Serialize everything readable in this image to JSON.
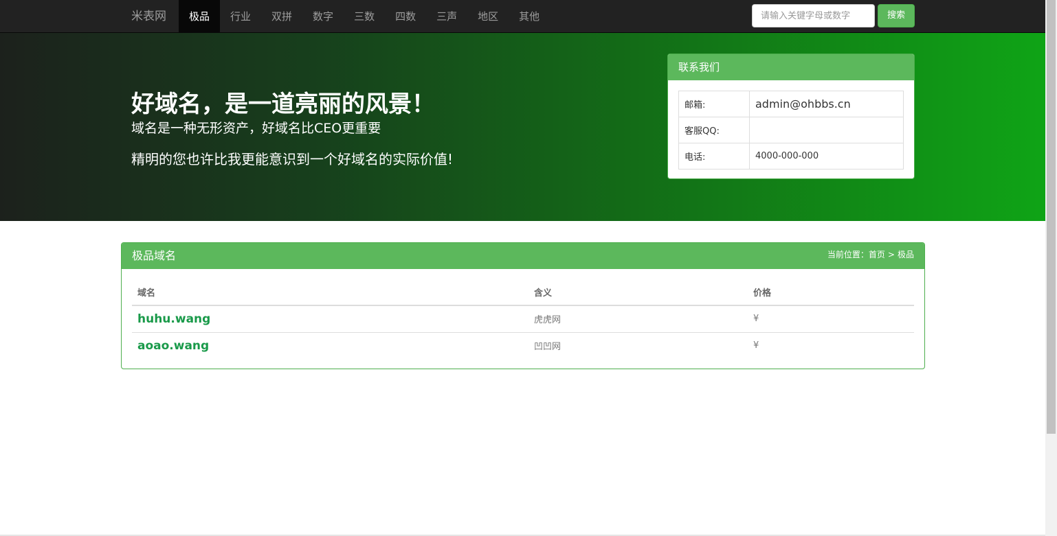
{
  "nav": {
    "brand": "米表网",
    "items": [
      {
        "label": "极品",
        "active": true
      },
      {
        "label": "行业",
        "active": false
      },
      {
        "label": "双拼",
        "active": false
      },
      {
        "label": "数字",
        "active": false
      },
      {
        "label": "三数",
        "active": false
      },
      {
        "label": "四数",
        "active": false
      },
      {
        "label": "三声",
        "active": false
      },
      {
        "label": "地区",
        "active": false
      },
      {
        "label": "其他",
        "active": false
      }
    ],
    "search_placeholder": "请输入关键字母或数字",
    "search_button": "搜索"
  },
  "hero": {
    "title": "好域名，是一道亮丽的风景！",
    "subtitle": "域名是一种无形资产，好域名比CEO更重要",
    "description": "精明的您也许比我更能意识到一个好域名的实际价值!"
  },
  "contact": {
    "heading": "联系我们",
    "rows": [
      {
        "label": "邮箱:",
        "value": "admin@ohbbs.cn"
      },
      {
        "label": "客服QQ:",
        "value": ""
      },
      {
        "label": "电话:",
        "value": "4000-000-000"
      }
    ]
  },
  "listing": {
    "title": "极品域名",
    "breadcrumb": {
      "prefix": "当前位置：",
      "home": "首页",
      "separator": ">",
      "current": "极品"
    },
    "columns": [
      "域名",
      "含义",
      "价格"
    ],
    "rows": [
      {
        "domain": "huhu.wang",
        "meaning": "虎虎网",
        "price": "¥"
      },
      {
        "domain": "aoao.wang",
        "meaning": "凹凹网",
        "price": "¥"
      }
    ]
  },
  "colors": {
    "navbar_bg": "#222222",
    "accent_green": "#5cb85c",
    "link_green": "#1a9a4a"
  }
}
